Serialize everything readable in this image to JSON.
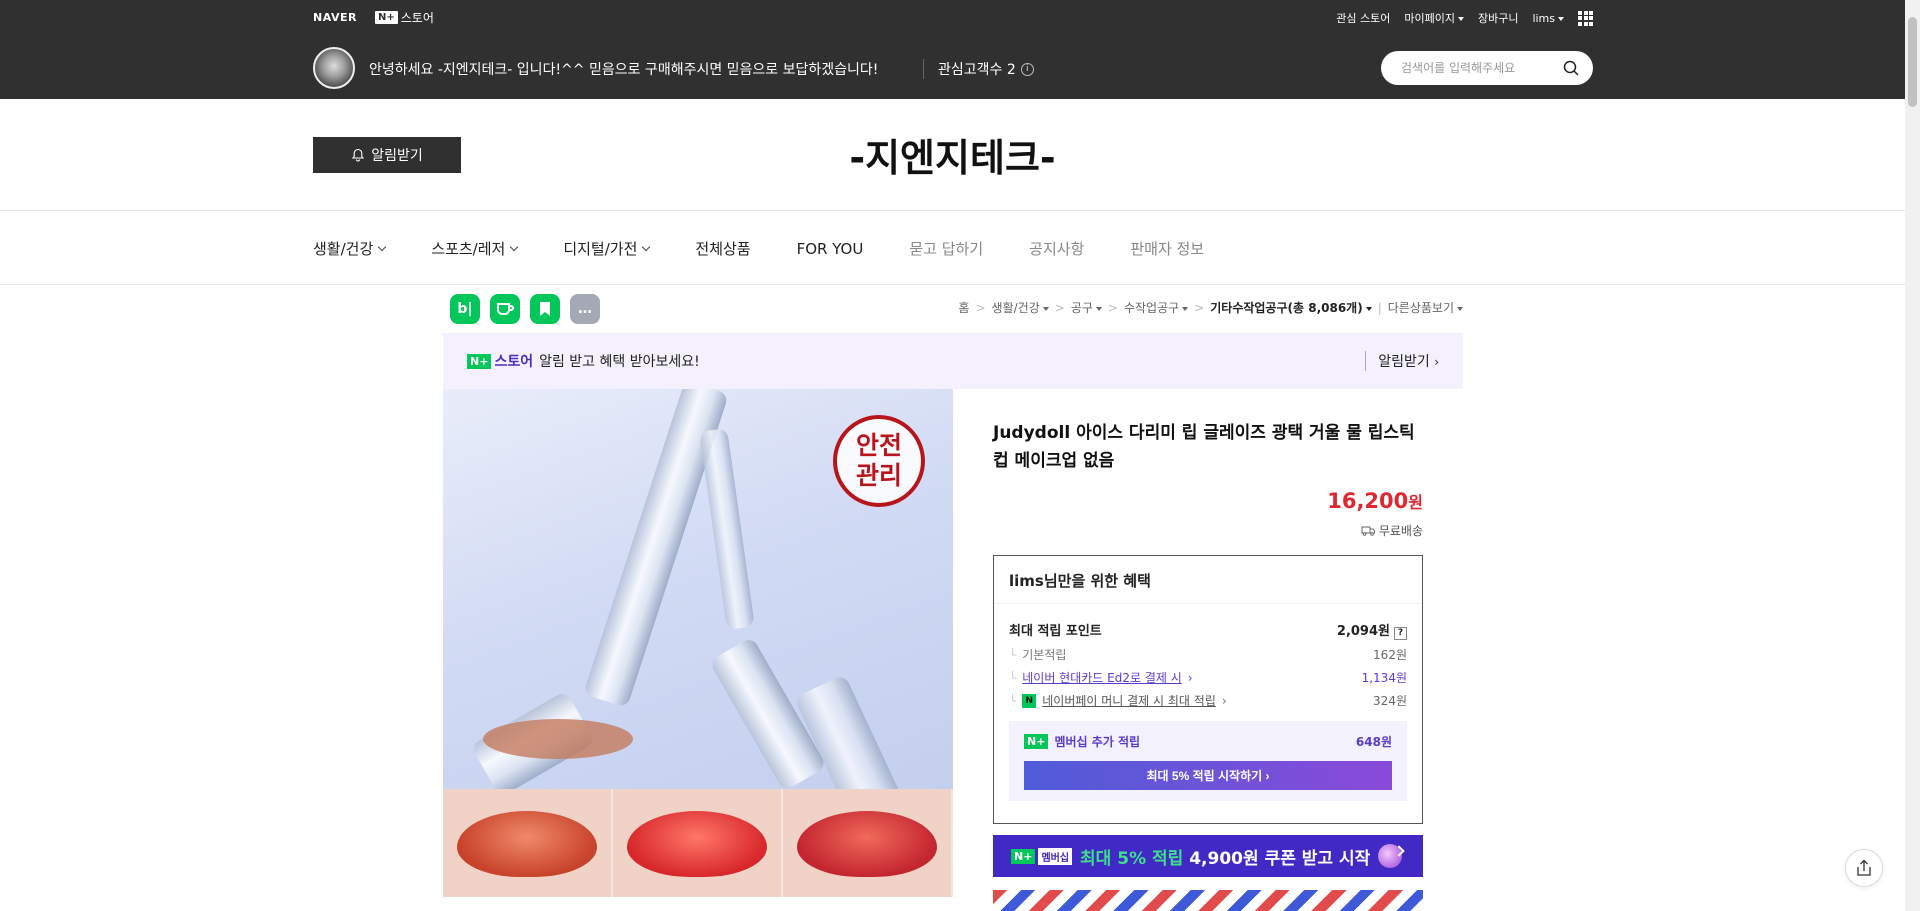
{
  "top": {
    "naver": "NAVER",
    "nplus": "N+",
    "store": "스토어",
    "links": [
      "관심 스토어",
      "마이페이지",
      "장바구니",
      "lims"
    ],
    "store_message": "안녕하세요 -지엔지테크- 입니다!^^ 믿음으로 구매해주시면 믿음으로 보답하겠습니다!",
    "interest_label": "관심고객수 2",
    "search_placeholder": "검색어를 입력해주세요"
  },
  "header": {
    "alarm_button": "알림받기",
    "store_name": "-지엔지테크-"
  },
  "catnav": {
    "items": [
      "생활/건강",
      "스포츠/레저",
      "디지털/가전",
      "전체상품",
      "FOR YOU",
      "묻고 답하기",
      "공지사항",
      "판매자 정보"
    ]
  },
  "share": {
    "blog": "b|",
    "more": "…"
  },
  "breadcrumb": {
    "items": [
      "홈",
      "생활/건강",
      "공구",
      "수작업공구"
    ],
    "current": "기타수작업공구(총 8,086개)",
    "other": "다른상품보기"
  },
  "promo": {
    "store": "스토어",
    "text": "알림 받고 혜택 받아보세요!",
    "alarm": "알림받기"
  },
  "product": {
    "stamp": "안전\n관리",
    "title": "Judydoll 아이스 다리미 립 글레이즈 광택 거울 물 립스틱 컵 메이크업 없음",
    "price": "16,200",
    "won": "원",
    "shipping": "무료배송"
  },
  "benefit": {
    "title": "lims님만을 위한 혜택",
    "max_label": "최대 적립 포인트",
    "max_value": "2,094원",
    "rows": [
      {
        "label": "기본적립",
        "value": "162원"
      },
      {
        "label": "네이버 현대카드 Ed2로 결제 시",
        "value": "1,134원"
      },
      {
        "label": "네이버페이 머니 결제 시 최대 적립",
        "value": "324원"
      }
    ],
    "member_label": "멤버십 추가 적립",
    "member_value": "648원",
    "member_button": "최대 5% 적립 시작하기"
  },
  "coupon": {
    "badge": "멤버십",
    "text_highlight": "최대 5% 적립",
    "text_rest": " 4,900원 쿠폰 받고 시작"
  },
  "colors": {
    "topbar": "#303030",
    "price": "#e0262e",
    "naver_green": "#03c75a",
    "membership_purple": "#5a3bd1",
    "coupon_bg": "#4129c6"
  }
}
